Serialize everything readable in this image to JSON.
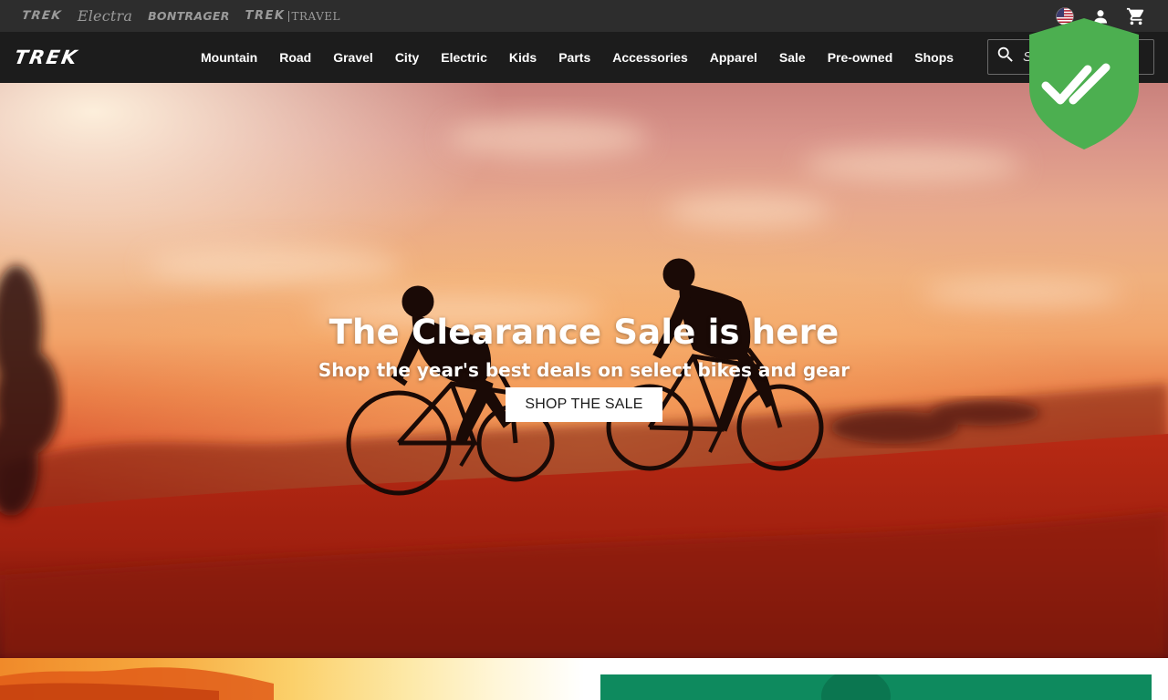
{
  "utility_bar": {
    "brands": [
      {
        "label": "TREK"
      },
      {
        "label": "Electra"
      },
      {
        "label": "BONTRAGER"
      },
      {
        "label_main": "TREK",
        "label_sub": "TRAVEL"
      }
    ],
    "icons": [
      "us-flag-icon",
      "account-icon",
      "cart-icon"
    ]
  },
  "nav": {
    "logo": "TREK",
    "items": [
      {
        "label": "Mountain"
      },
      {
        "label": "Road"
      },
      {
        "label": "Gravel"
      },
      {
        "label": "City"
      },
      {
        "label": "Electric"
      },
      {
        "label": "Kids"
      },
      {
        "label": "Parts"
      },
      {
        "label": "Accessories"
      },
      {
        "label": "Apparel"
      },
      {
        "label": "Sale"
      },
      {
        "label": "Pre-owned"
      },
      {
        "label": "Shops"
      }
    ],
    "search": {
      "placeholder": "S"
    }
  },
  "hero": {
    "title": "The Clearance Sale is here",
    "subtitle": "Shop the year's best deals on select bikes and gear",
    "cta": "SHOP THE SALE"
  },
  "colors": {
    "utility_bg": "#2d2d2d",
    "nav_bg": "#1c1c1c",
    "shield_green": "#4caf50",
    "tile_green": "#0e8a5e"
  }
}
